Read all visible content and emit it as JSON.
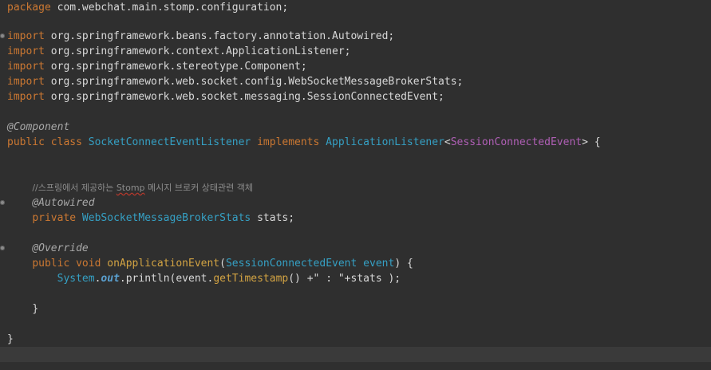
{
  "editor": {
    "line1": {
      "kw": "package",
      "rest": " com.webchat.main.stomp.configuration;"
    },
    "imports": [
      {
        "kw": "import",
        "rest": " org.springframework.beans.factory.annotation.Autowired;"
      },
      {
        "kw": "import",
        "rest": " org.springframework.context.ApplicationListener;"
      },
      {
        "kw": "import",
        "rest": " org.springframework.stereotype.Component;"
      },
      {
        "kw": "import",
        "rest": " org.springframework.web.socket.config.WebSocketMessageBrokerStats;"
      },
      {
        "kw": "import",
        "rest": " org.springframework.web.socket.messaging.SessionConnectedEvent;"
      }
    ],
    "annotation_component": "@Component",
    "class_decl": {
      "kw1": "public",
      "kw2": " class",
      "name": " SocketConnectEventListener",
      "kw3": " implements",
      "iface": " ApplicationListener",
      "lt": "<",
      "generic": "SessionConnectedEvent",
      "tail": "> {"
    },
    "comment": {
      "prefix": "//스프링에서 제공하는 ",
      "word": "Stomp",
      "suffix": " 메시지 브로커 상태관련 객체"
    },
    "annotation_autowired": "@Autowired",
    "field": {
      "kw": "private",
      "type": " WebSocketMessageBrokerStats",
      "name": " stats;"
    },
    "annotation_override": "@Override",
    "method_decl": {
      "kw1": "public",
      "kw2": " void",
      "name": " onApplicationEvent",
      "open": "(",
      "ptype": "SessionConnectedEvent",
      "pname": " event",
      "close": ") {"
    },
    "body_line": {
      "sys": "System",
      "dot1": ".",
      "out": "out",
      "print": ".println(event.",
      "getter": "getTimestamp",
      "mid": "() +\"",
      "str": " : ",
      "end": "\"+stats );"
    },
    "close_method": "}",
    "close_class": "}"
  }
}
